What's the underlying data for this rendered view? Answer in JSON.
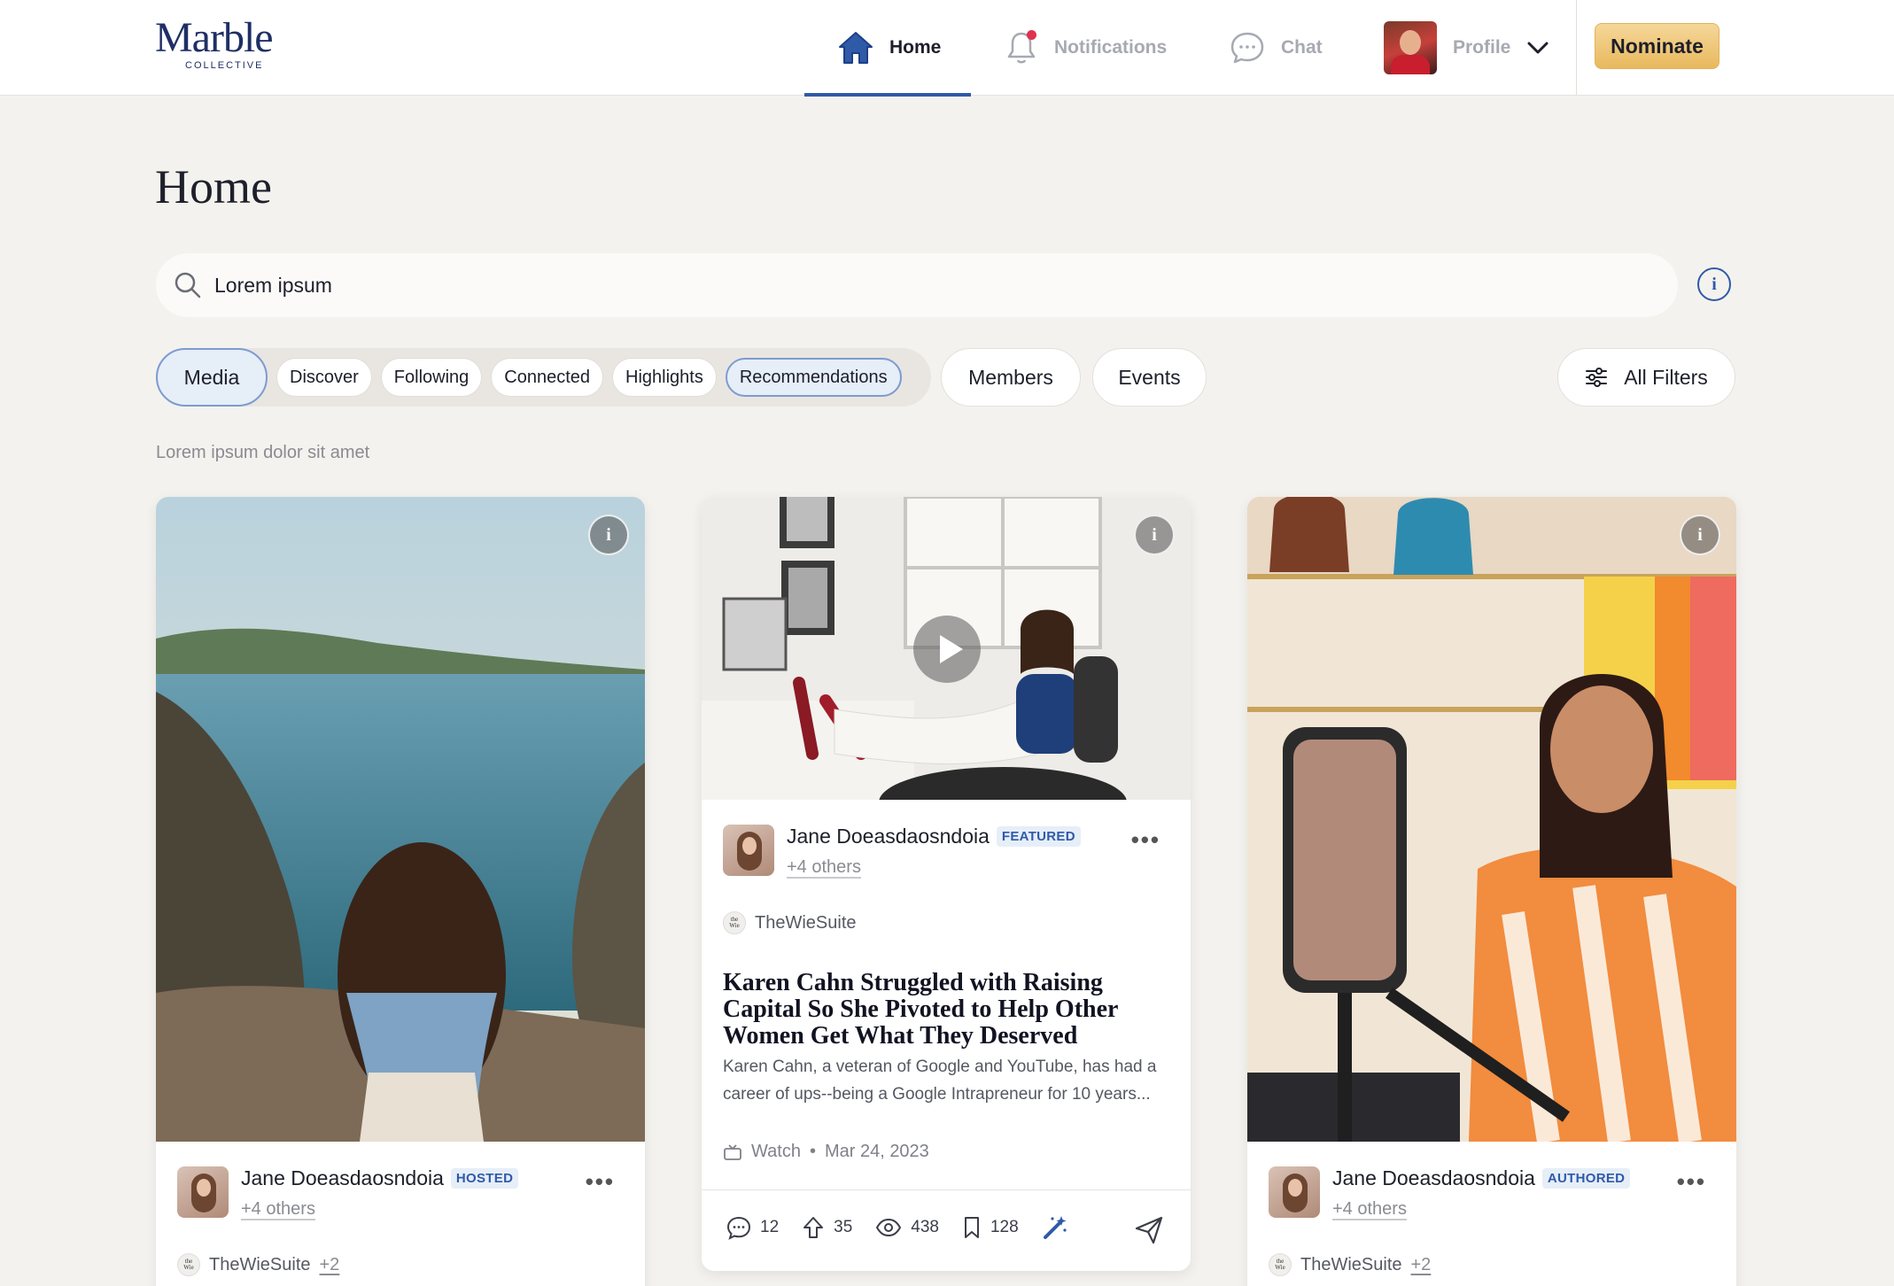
{
  "brand": {
    "name": "Marble",
    "sub": "COLLECTIVE"
  },
  "nav": {
    "home": "Home",
    "notifications": "Notifications",
    "chat": "Chat",
    "profile": "Profile",
    "nominate": "Nominate"
  },
  "page": {
    "title": "Home",
    "search_value": "Lorem ipsum",
    "subtitle": "Lorem ipsum dolor sit amet"
  },
  "tabs": {
    "media": "Media",
    "chips": [
      "Discover",
      "Following",
      "Connected",
      "Highlights",
      "Recommendations"
    ],
    "selected_chip": "Recommendations",
    "members": "Members",
    "events": "Events",
    "all_filters": "All Filters"
  },
  "cards": [
    {
      "author": "Jane Doeasdaosndoia",
      "badge": "HOSTED",
      "others": "+4 others",
      "source": "TheWieSuite",
      "source_extra": "+2"
    },
    {
      "author": "Jane Doeasdaosndoia",
      "badge": "FEATURED",
      "others": "+4 others",
      "source": "TheWieSuite",
      "headline": "Karen Cahn Struggled with Raising Capital So She Pivoted to Help Other Women Get What They Deserved",
      "description": "Karen Cahn, a veteran of Google and YouTube, has had a career of ups--being a Google Intrapreneur for 10 years...",
      "media_type": "Watch",
      "date": "Mar 24, 2023",
      "comments": "12",
      "upvotes": "35",
      "views": "438",
      "saves": "128"
    },
    {
      "author": "Jane Doeasdaosndoia",
      "badge": "AUTHORED",
      "others": "+4 others",
      "source": "TheWieSuite",
      "source_extra": "+2"
    }
  ],
  "colors": {
    "accent": "#2f5aa8",
    "nominate": "#e8b95d",
    "notif_dot": "#e0314f",
    "background": "#f4f2ee"
  },
  "icons": [
    "home-icon",
    "bell-icon",
    "chat-icon",
    "chevron-down-icon",
    "search-icon",
    "info-icon",
    "filter-icon",
    "play-icon",
    "more-icon",
    "tv-icon",
    "comment-icon",
    "upvote-icon",
    "eye-icon",
    "bookmark-icon",
    "magic-wand-icon",
    "send-icon"
  ]
}
